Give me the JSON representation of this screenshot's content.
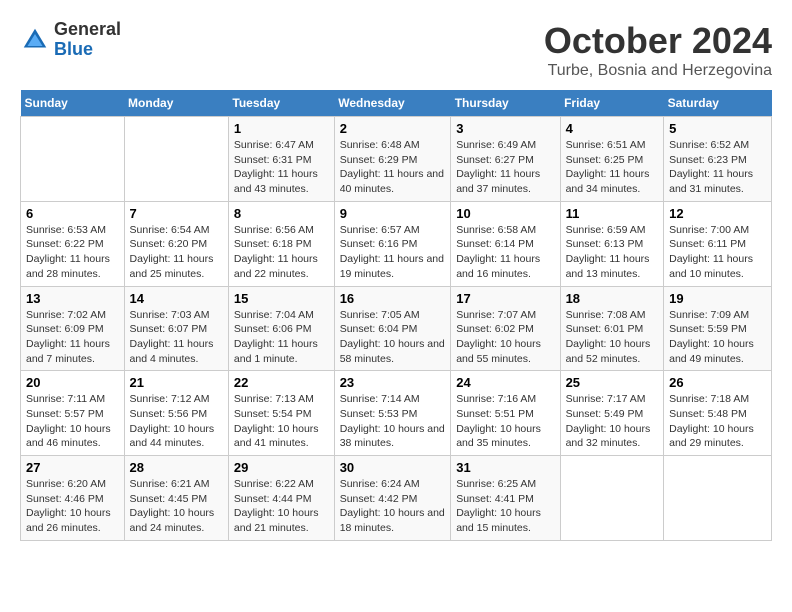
{
  "header": {
    "logo": {
      "general": "General",
      "blue": "Blue"
    },
    "month": "October 2024",
    "location": "Turbe, Bosnia and Herzegovina"
  },
  "weekdays": [
    "Sunday",
    "Monday",
    "Tuesday",
    "Wednesday",
    "Thursday",
    "Friday",
    "Saturday"
  ],
  "weeks": [
    [
      {
        "day": null
      },
      {
        "day": null
      },
      {
        "day": "1",
        "sunrise": "Sunrise: 6:47 AM",
        "sunset": "Sunset: 6:31 PM",
        "daylight": "Daylight: 11 hours and 43 minutes."
      },
      {
        "day": "2",
        "sunrise": "Sunrise: 6:48 AM",
        "sunset": "Sunset: 6:29 PM",
        "daylight": "Daylight: 11 hours and 40 minutes."
      },
      {
        "day": "3",
        "sunrise": "Sunrise: 6:49 AM",
        "sunset": "Sunset: 6:27 PM",
        "daylight": "Daylight: 11 hours and 37 minutes."
      },
      {
        "day": "4",
        "sunrise": "Sunrise: 6:51 AM",
        "sunset": "Sunset: 6:25 PM",
        "daylight": "Daylight: 11 hours and 34 minutes."
      },
      {
        "day": "5",
        "sunrise": "Sunrise: 6:52 AM",
        "sunset": "Sunset: 6:23 PM",
        "daylight": "Daylight: 11 hours and 31 minutes."
      }
    ],
    [
      {
        "day": "6",
        "sunrise": "Sunrise: 6:53 AM",
        "sunset": "Sunset: 6:22 PM",
        "daylight": "Daylight: 11 hours and 28 minutes."
      },
      {
        "day": "7",
        "sunrise": "Sunrise: 6:54 AM",
        "sunset": "Sunset: 6:20 PM",
        "daylight": "Daylight: 11 hours and 25 minutes."
      },
      {
        "day": "8",
        "sunrise": "Sunrise: 6:56 AM",
        "sunset": "Sunset: 6:18 PM",
        "daylight": "Daylight: 11 hours and 22 minutes."
      },
      {
        "day": "9",
        "sunrise": "Sunrise: 6:57 AM",
        "sunset": "Sunset: 6:16 PM",
        "daylight": "Daylight: 11 hours and 19 minutes."
      },
      {
        "day": "10",
        "sunrise": "Sunrise: 6:58 AM",
        "sunset": "Sunset: 6:14 PM",
        "daylight": "Daylight: 11 hours and 16 minutes."
      },
      {
        "day": "11",
        "sunrise": "Sunrise: 6:59 AM",
        "sunset": "Sunset: 6:13 PM",
        "daylight": "Daylight: 11 hours and 13 minutes."
      },
      {
        "day": "12",
        "sunrise": "Sunrise: 7:00 AM",
        "sunset": "Sunset: 6:11 PM",
        "daylight": "Daylight: 11 hours and 10 minutes."
      }
    ],
    [
      {
        "day": "13",
        "sunrise": "Sunrise: 7:02 AM",
        "sunset": "Sunset: 6:09 PM",
        "daylight": "Daylight: 11 hours and 7 minutes."
      },
      {
        "day": "14",
        "sunrise": "Sunrise: 7:03 AM",
        "sunset": "Sunset: 6:07 PM",
        "daylight": "Daylight: 11 hours and 4 minutes."
      },
      {
        "day": "15",
        "sunrise": "Sunrise: 7:04 AM",
        "sunset": "Sunset: 6:06 PM",
        "daylight": "Daylight: 11 hours and 1 minute."
      },
      {
        "day": "16",
        "sunrise": "Sunrise: 7:05 AM",
        "sunset": "Sunset: 6:04 PM",
        "daylight": "Daylight: 10 hours and 58 minutes."
      },
      {
        "day": "17",
        "sunrise": "Sunrise: 7:07 AM",
        "sunset": "Sunset: 6:02 PM",
        "daylight": "Daylight: 10 hours and 55 minutes."
      },
      {
        "day": "18",
        "sunrise": "Sunrise: 7:08 AM",
        "sunset": "Sunset: 6:01 PM",
        "daylight": "Daylight: 10 hours and 52 minutes."
      },
      {
        "day": "19",
        "sunrise": "Sunrise: 7:09 AM",
        "sunset": "Sunset: 5:59 PM",
        "daylight": "Daylight: 10 hours and 49 minutes."
      }
    ],
    [
      {
        "day": "20",
        "sunrise": "Sunrise: 7:11 AM",
        "sunset": "Sunset: 5:57 PM",
        "daylight": "Daylight: 10 hours and 46 minutes."
      },
      {
        "day": "21",
        "sunrise": "Sunrise: 7:12 AM",
        "sunset": "Sunset: 5:56 PM",
        "daylight": "Daylight: 10 hours and 44 minutes."
      },
      {
        "day": "22",
        "sunrise": "Sunrise: 7:13 AM",
        "sunset": "Sunset: 5:54 PM",
        "daylight": "Daylight: 10 hours and 41 minutes."
      },
      {
        "day": "23",
        "sunrise": "Sunrise: 7:14 AM",
        "sunset": "Sunset: 5:53 PM",
        "daylight": "Daylight: 10 hours and 38 minutes."
      },
      {
        "day": "24",
        "sunrise": "Sunrise: 7:16 AM",
        "sunset": "Sunset: 5:51 PM",
        "daylight": "Daylight: 10 hours and 35 minutes."
      },
      {
        "day": "25",
        "sunrise": "Sunrise: 7:17 AM",
        "sunset": "Sunset: 5:49 PM",
        "daylight": "Daylight: 10 hours and 32 minutes."
      },
      {
        "day": "26",
        "sunrise": "Sunrise: 7:18 AM",
        "sunset": "Sunset: 5:48 PM",
        "daylight": "Daylight: 10 hours and 29 minutes."
      }
    ],
    [
      {
        "day": "27",
        "sunrise": "Sunrise: 6:20 AM",
        "sunset": "Sunset: 4:46 PM",
        "daylight": "Daylight: 10 hours and 26 minutes."
      },
      {
        "day": "28",
        "sunrise": "Sunrise: 6:21 AM",
        "sunset": "Sunset: 4:45 PM",
        "daylight": "Daylight: 10 hours and 24 minutes."
      },
      {
        "day": "29",
        "sunrise": "Sunrise: 6:22 AM",
        "sunset": "Sunset: 4:44 PM",
        "daylight": "Daylight: 10 hours and 21 minutes."
      },
      {
        "day": "30",
        "sunrise": "Sunrise: 6:24 AM",
        "sunset": "Sunset: 4:42 PM",
        "daylight": "Daylight: 10 hours and 18 minutes."
      },
      {
        "day": "31",
        "sunrise": "Sunrise: 6:25 AM",
        "sunset": "Sunset: 4:41 PM",
        "daylight": "Daylight: 10 hours and 15 minutes."
      },
      {
        "day": null
      },
      {
        "day": null
      }
    ]
  ]
}
